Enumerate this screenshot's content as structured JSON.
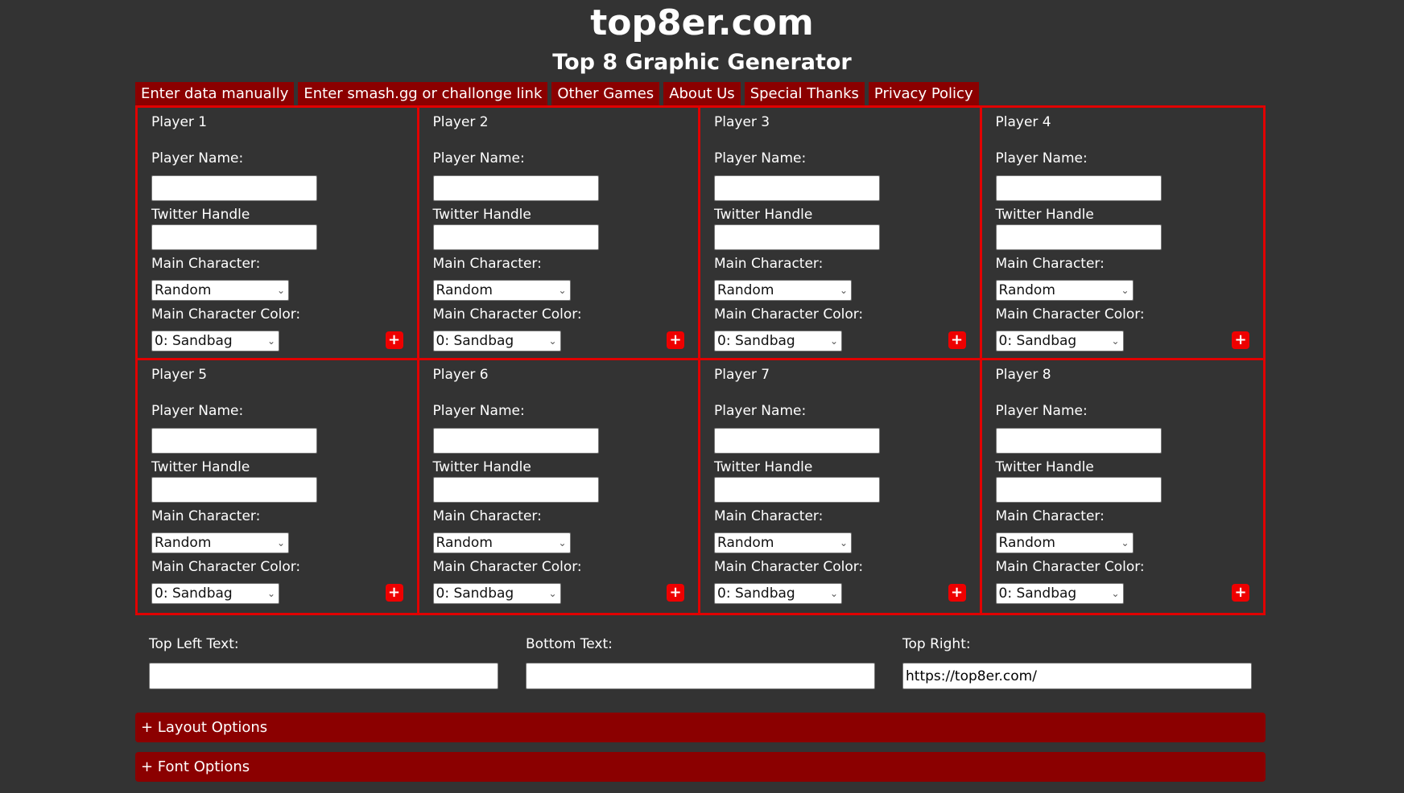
{
  "header": {
    "site_title": "top8er.com",
    "subtitle": "Top 8 Graphic Generator"
  },
  "nav": {
    "tabs": [
      {
        "label": "Enter data manually"
      },
      {
        "label": "Enter smash.gg or challonge link"
      },
      {
        "label": "Other Games"
      },
      {
        "label": "About Us"
      },
      {
        "label": "Special Thanks"
      },
      {
        "label": "Privacy Policy"
      }
    ]
  },
  "form_labels": {
    "player_name": "Player Name:",
    "twitter_handle": "Twitter Handle",
    "main_character": "Main Character:",
    "main_character_color": "Main Character Color:",
    "add_button": "+"
  },
  "players": [
    {
      "title": "Player 1",
      "name": "",
      "twitter": "",
      "character": "Random",
      "color": "0: Sandbag"
    },
    {
      "title": "Player 2",
      "name": "",
      "twitter": "",
      "character": "Random",
      "color": "0: Sandbag"
    },
    {
      "title": "Player 3",
      "name": "",
      "twitter": "",
      "character": "Random",
      "color": "0: Sandbag"
    },
    {
      "title": "Player 4",
      "name": "",
      "twitter": "",
      "character": "Random",
      "color": "0: Sandbag"
    },
    {
      "title": "Player 5",
      "name": "",
      "twitter": "",
      "character": "Random",
      "color": "0: Sandbag"
    },
    {
      "title": "Player 6",
      "name": "",
      "twitter": "",
      "character": "Random",
      "color": "0: Sandbag"
    },
    {
      "title": "Player 7",
      "name": "",
      "twitter": "",
      "character": "Random",
      "color": "0: Sandbag"
    },
    {
      "title": "Player 8",
      "name": "",
      "twitter": "",
      "character": "Random",
      "color": "0: Sandbag"
    }
  ],
  "extra_text": {
    "top_left": {
      "label": "Top Left Text:",
      "value": ""
    },
    "bottom": {
      "label": "Bottom Text:",
      "value": ""
    },
    "top_right": {
      "label": "Top Right:",
      "value": "https://top8er.com/"
    }
  },
  "accordions": {
    "layout_options": "+ Layout Options",
    "font_options": "+ Font Options"
  },
  "colors": {
    "background": "#333333",
    "accent_red": "#8b0000",
    "grid_border": "#e10000",
    "plus_button": "#ee0000"
  }
}
